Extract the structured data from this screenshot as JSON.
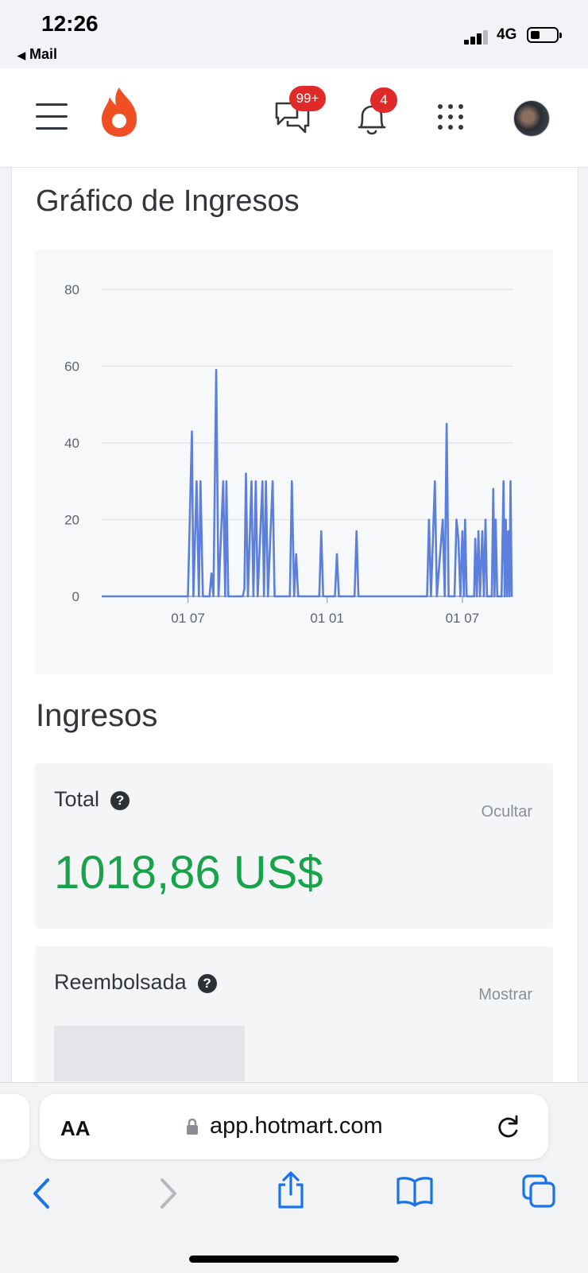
{
  "status_bar": {
    "time": "12:26",
    "back_app": "Mail",
    "network": "4G"
  },
  "header": {
    "messages_badge": "99+",
    "notifications_badge": "4",
    "icons": [
      "menu-icon",
      "flame-logo-icon",
      "chat-icon",
      "bell-icon",
      "apps-grid-icon",
      "avatar"
    ]
  },
  "chart_section": {
    "title": "Gráfico de Ingresos"
  },
  "chart_data": {
    "type": "line",
    "title": "Gráfico de Ingresos",
    "xlabel": "",
    "ylabel": "",
    "ylim": [
      0,
      80
    ],
    "yticks": [
      "0",
      "20",
      "40",
      "60",
      "80"
    ],
    "xtick_labels": [
      "01 07",
      "01 01",
      "01 07"
    ],
    "grid": true,
    "color": "#5b7fdb",
    "series": [
      {
        "points": [
          [
            0,
            0
          ],
          [
            22,
            0
          ],
          [
            23,
            43
          ],
          [
            23.4,
            0
          ],
          [
            24.2,
            30
          ],
          [
            24.8,
            0
          ],
          [
            25.2,
            30
          ],
          [
            25.8,
            0
          ],
          [
            27.5,
            0
          ],
          [
            28,
            6
          ],
          [
            28.5,
            0
          ],
          [
            29.2,
            59
          ],
          [
            29.8,
            0
          ],
          [
            31,
            30
          ],
          [
            31.5,
            0
          ],
          [
            31.8,
            30
          ],
          [
            32.3,
            0
          ],
          [
            36,
            0
          ],
          [
            36.4,
            2
          ],
          [
            36.8,
            32
          ],
          [
            37.3,
            0
          ],
          [
            38.2,
            30
          ],
          [
            38.7,
            0
          ],
          [
            39.3,
            30
          ],
          [
            39.8,
            0
          ],
          [
            41,
            30
          ],
          [
            41.4,
            0
          ],
          [
            41.9,
            30
          ],
          [
            42.4,
            0
          ],
          [
            43.6,
            30
          ],
          [
            44.1,
            0
          ],
          [
            48,
            0
          ],
          [
            48.5,
            30
          ],
          [
            49.1,
            0
          ],
          [
            49.6,
            11
          ],
          [
            50.1,
            0
          ],
          [
            55.5,
            0
          ],
          [
            56,
            17
          ],
          [
            56.5,
            0
          ],
          [
            59.5,
            0
          ],
          [
            60,
            11
          ],
          [
            60.5,
            0
          ],
          [
            64.5,
            0
          ],
          [
            65,
            17
          ],
          [
            65.5,
            0
          ],
          [
            83,
            0
          ],
          [
            83.5,
            20
          ],
          [
            84,
            0
          ],
          [
            85,
            30
          ],
          [
            85.5,
            0
          ],
          [
            87,
            20
          ],
          [
            87.5,
            0
          ],
          [
            88,
            45
          ],
          [
            88.5,
            0
          ],
          [
            90,
            0
          ],
          [
            90.5,
            20
          ],
          [
            91,
            15
          ],
          [
            91.5,
            0
          ],
          [
            92,
            17
          ],
          [
            92.4,
            0
          ],
          [
            92.7,
            20
          ],
          [
            93.1,
            0
          ],
          [
            95,
            0
          ],
          [
            95.3,
            15
          ],
          [
            95.7,
            0
          ],
          [
            96.1,
            17
          ],
          [
            96.5,
            0
          ],
          [
            97.1,
            17
          ],
          [
            97.5,
            0
          ],
          [
            97.9,
            20
          ],
          [
            98.3,
            0
          ],
          [
            99.5,
            0
          ],
          [
            99.9,
            28
          ],
          [
            100.2,
            0
          ],
          [
            100.5,
            20
          ],
          [
            100.9,
            0
          ],
          [
            102,
            0
          ],
          [
            102.5,
            30
          ],
          [
            102.8,
            0
          ],
          [
            103.1,
            20
          ],
          [
            103.4,
            0
          ],
          [
            103.7,
            17
          ],
          [
            104,
            0
          ],
          [
            104.3,
            30
          ],
          [
            104.6,
            0
          ]
        ]
      }
    ]
  },
  "ingresos": {
    "title": "Ingresos",
    "total": {
      "label": "Total",
      "help": "?",
      "action": "Ocultar",
      "value": "1018,86 US$"
    },
    "refund": {
      "label": "Reembolsada",
      "help": "?",
      "action": "Mostrar"
    }
  },
  "browser": {
    "text_size_label": "AA",
    "url": "app.hotmart.com"
  }
}
